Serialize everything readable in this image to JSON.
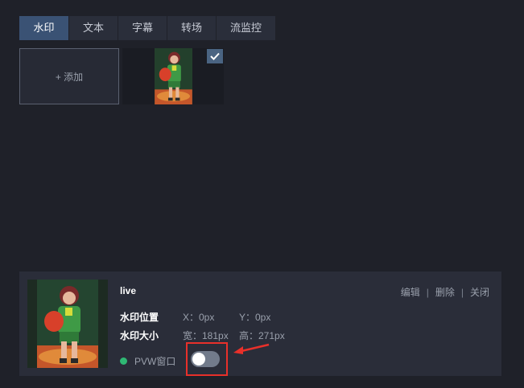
{
  "tabs": [
    {
      "label": "水印",
      "active": true
    },
    {
      "label": "文本",
      "active": false
    },
    {
      "label": "字幕",
      "active": false
    },
    {
      "label": "转场",
      "active": false
    },
    {
      "label": "流监控",
      "active": false
    }
  ],
  "gallery": {
    "add_label": "+ 添加",
    "item_checked": true,
    "check_icon": "checkmark-icon"
  },
  "watermark": {
    "name": "live",
    "actions": {
      "edit": "编辑",
      "delete": "删除",
      "close": "关闭",
      "separator": "|"
    },
    "position_label": "水印位置",
    "position_x": "X：0px",
    "position_y": "Y：0px",
    "size_label": "水印大小",
    "width": "宽：181px",
    "height": "高：271px",
    "pvw_label": "PVW窗口",
    "pvw_status_color": "#2fb874",
    "pvw_toggle_on": false
  },
  "colors": {
    "background": "#1f2129",
    "panel": "#2a2d39",
    "active_tab": "#3a5274",
    "highlight": "#e8302a"
  }
}
